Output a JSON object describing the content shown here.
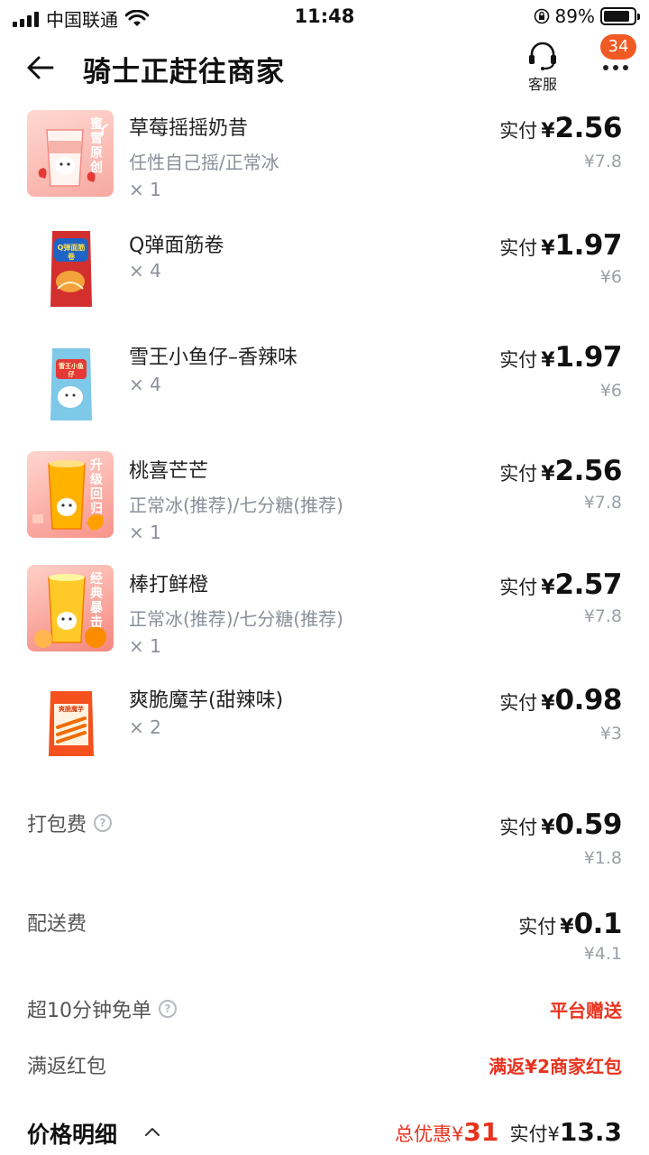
{
  "status_bar": {
    "carrier": "中国联通",
    "time": "11:48",
    "battery": "89%",
    "battery_level": 0.89
  },
  "header": {
    "title": "骑士正赶往商家",
    "service_label": "客服",
    "badge_count": "34"
  },
  "colors": {
    "accent_red": "#e8331f",
    "badge_orange": "#f15a24",
    "muted_text": "#8a8f99"
  },
  "items": [
    {
      "name": "草莓摇摇奶昔",
      "spec": "任性自己摇/正常冰",
      "qty": "× 1",
      "paid_label": "实付",
      "currency": "¥",
      "paid": "2.56",
      "original": "¥7.8"
    },
    {
      "name": "Q弹面筋卷",
      "spec": "",
      "qty": "× 4",
      "paid_label": "实付",
      "currency": "¥",
      "paid": "1.97",
      "original": "¥6"
    },
    {
      "name": "雪王小鱼仔–香辣味",
      "spec": "",
      "qty": "× 4",
      "paid_label": "实付",
      "currency": "¥",
      "paid": "1.97",
      "original": "¥6"
    },
    {
      "name": "桃喜芒芒",
      "spec": "正常冰(推荐)/七分糖(推荐)",
      "qty": "× 1",
      "paid_label": "实付",
      "currency": "¥",
      "paid": "2.56",
      "original": "¥7.8"
    },
    {
      "name": "棒打鲜橙",
      "spec": "正常冰(推荐)/七分糖(推荐)",
      "qty": "× 1",
      "paid_label": "实付",
      "currency": "¥",
      "paid": "2.57",
      "original": "¥7.8"
    },
    {
      "name": "爽脆魔芋(甜辣味)",
      "spec": "",
      "qty": "× 2",
      "paid_label": "实付",
      "currency": "¥",
      "paid": "0.98",
      "original": "¥3"
    }
  ],
  "fees": {
    "packing": {
      "label": "打包费",
      "paid_label": "实付",
      "currency": "¥",
      "paid": "0.59",
      "original": "¥1.8"
    },
    "delivery": {
      "label": "配送费",
      "paid_label": "实付",
      "currency": "¥",
      "paid": "0.1",
      "original": "¥4.1"
    },
    "free_order": {
      "label": "超10分钟免单",
      "value": "平台赠送"
    },
    "red_packet": {
      "label": "满返红包",
      "value": "满返¥2商家红包"
    }
  },
  "bottom": {
    "detail_label": "价格明细",
    "discount_label": "总优惠",
    "currency": "¥",
    "discount": "31",
    "total_label": "实付",
    "total": "13.3"
  },
  "thumb_texts": {
    "item0_badge": "蜜雪原创",
    "item3_badge": "升级回归",
    "item4_badge": "经典暴击",
    "item1_pack": "Q弹面筋卷",
    "item2_pack": "雪王小鱼仔",
    "item5_pack": "爽脆魔芋"
  }
}
